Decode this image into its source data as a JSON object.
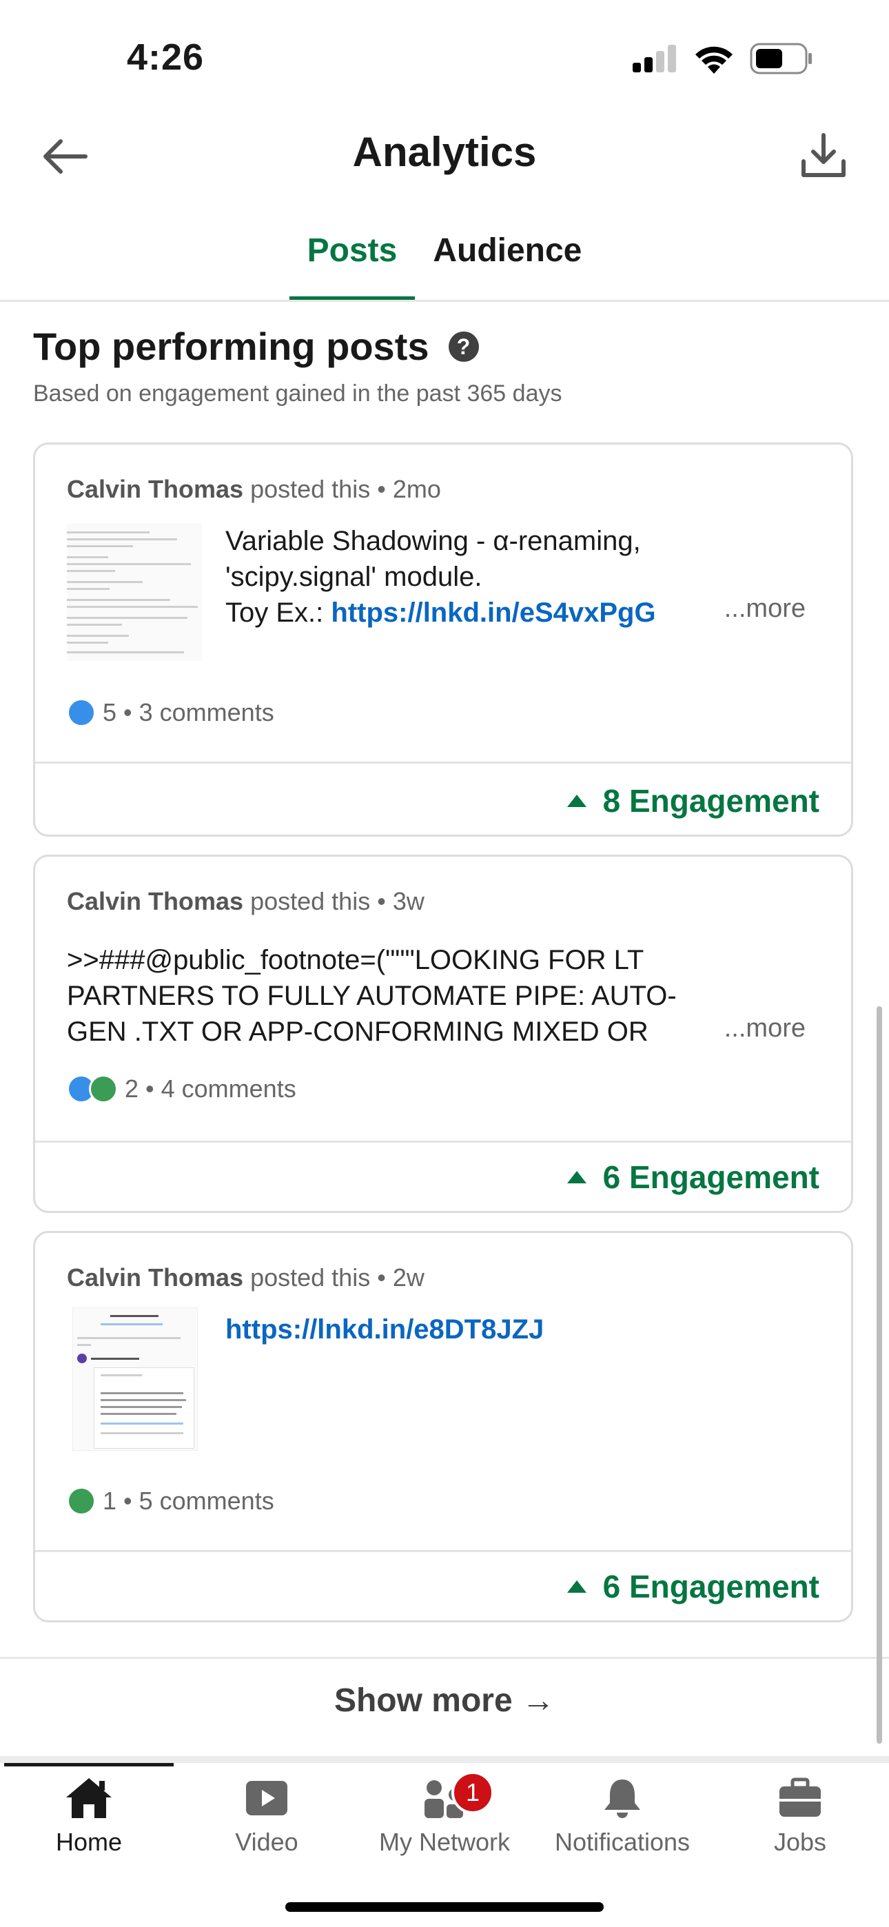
{
  "status_bar": {
    "time": "4:26"
  },
  "header": {
    "title": "Analytics"
  },
  "tabs": [
    {
      "label": "Posts",
      "active": true
    },
    {
      "label": "Audience",
      "active": false
    }
  ],
  "section": {
    "title": "Top performing posts",
    "subtitle": "Based on engagement gained in the past 365 days",
    "help_symbol": "?"
  },
  "posts": [
    {
      "author": "Calvin Thomas",
      "posted_text": "posted this",
      "age": "2mo",
      "text_line1": "Variable Shadowing - α-renaming,",
      "text_line2": "'scipy.signal' module.",
      "text_line3_prefix": "Toy Ex.: ",
      "link": "https://lnkd.in/eS4vxPgG",
      "more": "...more",
      "reactions": "5",
      "comments": "3 comments",
      "engagement": "8 Engagement",
      "thumbnail": "code-screenshot"
    },
    {
      "author": "Calvin Thomas",
      "posted_text": "posted this",
      "age": "3w",
      "text_line1": ">>###@public_footnote=(\"\"\"LOOKING FOR LT",
      "text_line2": "PARTNERS TO FULLY AUTOMATE PIPE: AUTO-",
      "text_line3": "GEN .TXT OR APP-CONFORMING MIXED OR",
      "more": "...more",
      "reactions": "2",
      "comments": "4 comments",
      "engagement": "6 Engagement"
    },
    {
      "author": "Calvin Thomas",
      "posted_text": "posted this",
      "age": "2w",
      "link": "https://lnkd.in/e8DT8JZJ",
      "reactions": "1",
      "comments": "5 comments",
      "engagement": "6 Engagement",
      "thumbnail": "repository-screenshot"
    }
  ],
  "show_more": "Show more →",
  "bottom_nav": [
    {
      "label": "Home",
      "icon": "home-icon",
      "active": true
    },
    {
      "label": "Video",
      "icon": "video-icon",
      "active": false
    },
    {
      "label": "My Network",
      "icon": "network-icon",
      "active": false,
      "badge": "1"
    },
    {
      "label": "Notifications",
      "icon": "bell-icon",
      "active": false
    },
    {
      "label": "Jobs",
      "icon": "briefcase-icon",
      "active": false
    }
  ],
  "colors": {
    "accent": "#057642",
    "link": "#0a66c2",
    "badge": "#cc1016"
  }
}
